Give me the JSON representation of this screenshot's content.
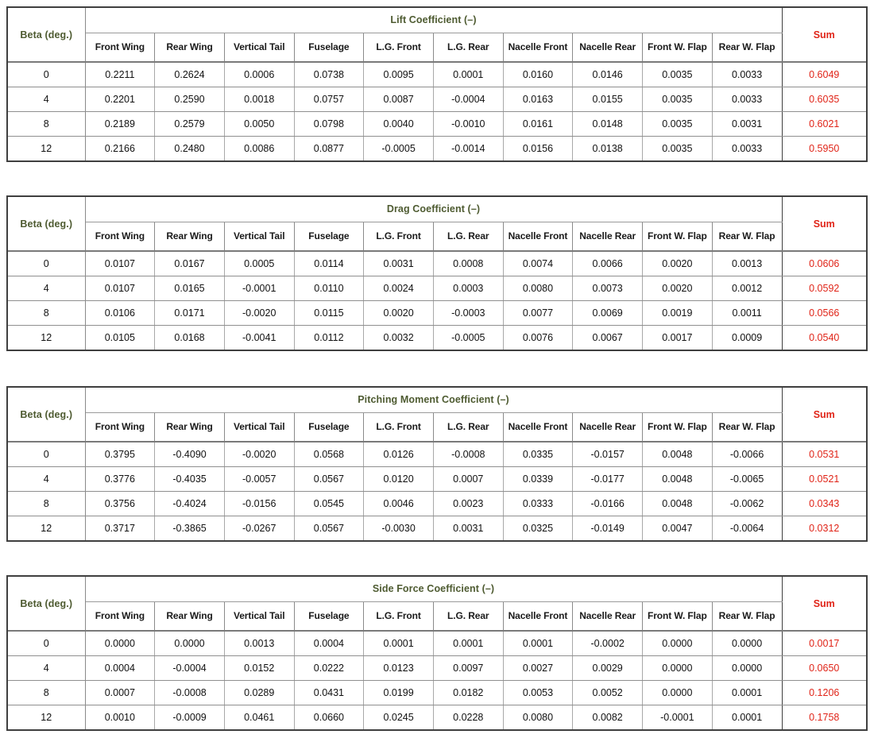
{
  "document": {
    "kind": "aerodynamic-coefficient-breakdown-tables",
    "beta_header": "Beta (deg.)",
    "sum_header": "Sum",
    "component_headers": [
      "Front Wing",
      "Rear Wing",
      "Vertical Tail",
      "Fuselage",
      "L.G. Front",
      "L.G. Rear",
      "Nacelle Front",
      "Nacelle Rear",
      "Front W. Flap",
      "Rear W. Flap"
    ],
    "beta_values": [
      "0",
      "4",
      "8",
      "12"
    ],
    "colors": {
      "group_title": "#4e5b31",
      "beta_label": "#4e5b31",
      "sum": "#e02418",
      "cell_text": "#111111",
      "border_outer": "#3f3f3f",
      "border_inner": "#8f8f8f"
    }
  },
  "tables": [
    {
      "id": "lift-coefficient",
      "title": "Lift Coefficient (–)",
      "rows": [
        {
          "beta": "0",
          "values": [
            "0.2211",
            "0.2624",
            "0.0006",
            "0.0738",
            "0.0095",
            "0.0001",
            "0.0160",
            "0.0146",
            "0.0035",
            "0.0033"
          ],
          "sum": "0.6049"
        },
        {
          "beta": "4",
          "values": [
            "0.2201",
            "0.2590",
            "0.0018",
            "0.0757",
            "0.0087",
            "-0.0004",
            "0.0163",
            "0.0155",
            "0.0035",
            "0.0033"
          ],
          "sum": "0.6035"
        },
        {
          "beta": "8",
          "values": [
            "0.2189",
            "0.2579",
            "0.0050",
            "0.0798",
            "0.0040",
            "-0.0010",
            "0.0161",
            "0.0148",
            "0.0035",
            "0.0031"
          ],
          "sum": "0.6021"
        },
        {
          "beta": "12",
          "values": [
            "0.2166",
            "0.2480",
            "0.0086",
            "0.0877",
            "-0.0005",
            "-0.0014",
            "0.0156",
            "0.0138",
            "0.0035",
            "0.0033"
          ],
          "sum": "0.5950"
        }
      ]
    },
    {
      "id": "drag-coefficient",
      "title": "Drag Coefficient (–)",
      "rows": [
        {
          "beta": "0",
          "values": [
            "0.0107",
            "0.0167",
            "0.0005",
            "0.0114",
            "0.0031",
            "0.0008",
            "0.0074",
            "0.0066",
            "0.0020",
            "0.0013"
          ],
          "sum": "0.0606"
        },
        {
          "beta": "4",
          "values": [
            "0.0107",
            "0.0165",
            "-0.0001",
            "0.0110",
            "0.0024",
            "0.0003",
            "0.0080",
            "0.0073",
            "0.0020",
            "0.0012"
          ],
          "sum": "0.0592"
        },
        {
          "beta": "8",
          "values": [
            "0.0106",
            "0.0171",
            "-0.0020",
            "0.0115",
            "0.0020",
            "-0.0003",
            "0.0077",
            "0.0069",
            "0.0019",
            "0.0011"
          ],
          "sum": "0.0566"
        },
        {
          "beta": "12",
          "values": [
            "0.0105",
            "0.0168",
            "-0.0041",
            "0.0112",
            "0.0032",
            "-0.0005",
            "0.0076",
            "0.0067",
            "0.0017",
            "0.0009"
          ],
          "sum": "0.0540"
        }
      ]
    },
    {
      "id": "pitching-moment-coefficient",
      "title": "Pitching Moment Coefficient (–)",
      "rows": [
        {
          "beta": "0",
          "values": [
            "0.3795",
            "-0.4090",
            "-0.0020",
            "0.0568",
            "0.0126",
            "-0.0008",
            "0.0335",
            "-0.0157",
            "0.0048",
            "-0.0066"
          ],
          "sum": "0.0531"
        },
        {
          "beta": "4",
          "values": [
            "0.3776",
            "-0.4035",
            "-0.0057",
            "0.0567",
            "0.0120",
            "0.0007",
            "0.0339",
            "-0.0177",
            "0.0048",
            "-0.0065"
          ],
          "sum": "0.0521"
        },
        {
          "beta": "8",
          "values": [
            "0.3756",
            "-0.4024",
            "-0.0156",
            "0.0545",
            "0.0046",
            "0.0023",
            "0.0333",
            "-0.0166",
            "0.0048",
            "-0.0062"
          ],
          "sum": "0.0343"
        },
        {
          "beta": "12",
          "values": [
            "0.3717",
            "-0.3865",
            "-0.0267",
            "0.0567",
            "-0.0030",
            "0.0031",
            "0.0325",
            "-0.0149",
            "0.0047",
            "-0.0064"
          ],
          "sum": "0.0312"
        }
      ]
    },
    {
      "id": "side-force-coefficient",
      "title": "Side Force Coefficient (–)",
      "rows": [
        {
          "beta": "0",
          "values": [
            "0.0000",
            "0.0000",
            "0.0013",
            "0.0004",
            "0.0001",
            "0.0001",
            "0.0001",
            "-0.0002",
            "0.0000",
            "0.0000"
          ],
          "sum": "0.0017"
        },
        {
          "beta": "4",
          "values": [
            "0.0004",
            "-0.0004",
            "0.0152",
            "0.0222",
            "0.0123",
            "0.0097",
            "0.0027",
            "0.0029",
            "0.0000",
            "0.0000"
          ],
          "sum": "0.0650"
        },
        {
          "beta": "8",
          "values": [
            "0.0007",
            "-0.0008",
            "0.0289",
            "0.0431",
            "0.0199",
            "0.0182",
            "0.0053",
            "0.0052",
            "0.0000",
            "0.0001"
          ],
          "sum": "0.1206"
        },
        {
          "beta": "12",
          "values": [
            "0.0010",
            "-0.0009",
            "0.0461",
            "0.0660",
            "0.0245",
            "0.0228",
            "0.0080",
            "0.0082",
            "-0.0001",
            "0.0001"
          ],
          "sum": "0.1758"
        }
      ]
    }
  ],
  "layout": {
    "table_tops": [
      8,
      246,
      486,
      724
    ]
  }
}
